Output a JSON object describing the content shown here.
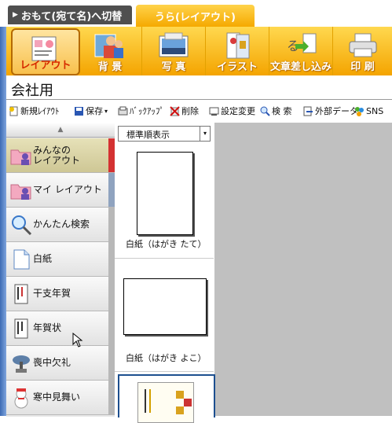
{
  "tabs": {
    "front": "おもて(宛て名)へ切替",
    "back": "うら(レイアウト)"
  },
  "toolbar": [
    {
      "label": "レイアウト",
      "icon": "layout-card-icon"
    },
    {
      "label": "背 景",
      "icon": "background-people-icon"
    },
    {
      "label": "写 真",
      "icon": "photo-icon"
    },
    {
      "label": "イラスト",
      "icon": "illustration-icon"
    },
    {
      "label": "文章差し込み",
      "icon": "text-insert-icon"
    },
    {
      "label": "印 刷",
      "icon": "printer-icon"
    }
  ],
  "page_title": "会社用",
  "actions": [
    {
      "label": "新規ﾚｲｱｳﾄ",
      "icon": "new-layout-icon"
    },
    {
      "label": "保存",
      "icon": "save-icon"
    },
    {
      "label": "ﾊﾞｯｸｱｯﾌﾟ",
      "icon": "backup-icon"
    },
    {
      "label": "削除",
      "icon": "delete-icon"
    },
    {
      "label": "設定変更",
      "icon": "settings-icon"
    },
    {
      "label": "検 索",
      "icon": "search-icon"
    },
    {
      "label": "外部データ",
      "icon": "external-data-icon"
    },
    {
      "label": "SNS",
      "icon": "sns-icon"
    }
  ],
  "sidebar": {
    "scroll_up": "▲",
    "items": [
      {
        "label": "みんなの\nレイアウト",
        "icon": "folder-people-icon",
        "selected": true
      },
      {
        "label": "マイ レイアウト",
        "icon": "folder-people-icon"
      },
      {
        "label": "かんたん検索",
        "icon": "magnifier-icon"
      },
      {
        "label": "白紙",
        "icon": "blank-page-icon"
      },
      {
        "label": "干支年賀",
        "icon": "card-icon"
      },
      {
        "label": "年賀状",
        "icon": "card-icon"
      },
      {
        "label": "喪中欠礼",
        "icon": "bonsai-icon"
      },
      {
        "label": "寒中見舞い",
        "icon": "snowman-icon"
      }
    ]
  },
  "sort": {
    "value": "標準順表示",
    "arrow": "▾"
  },
  "thumbnails": [
    {
      "caption": "白紙（はがき たて）"
    },
    {
      "caption": "白紙（はがき よこ）"
    },
    {
      "caption": ""
    }
  ],
  "colors": {
    "toolbar": "#f4a400",
    "accent_red": "#d62b00",
    "selected_item": "#d9d4a8"
  }
}
